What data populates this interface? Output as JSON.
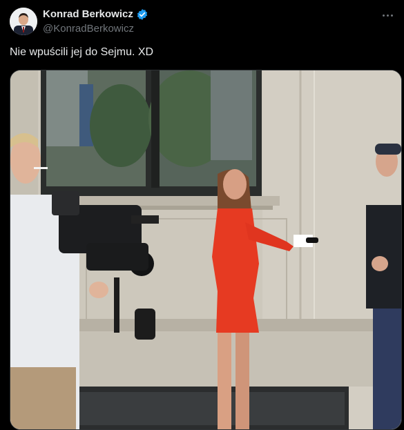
{
  "author": {
    "display_name": "Konrad Berkowicz",
    "handle": "@KonradBerkowicz"
  },
  "tweet": {
    "text": "Nie wpuścili jej do Sejmu. XD"
  },
  "icons": {
    "verified": "verified-badge-icon",
    "more": "more-options-icon"
  },
  "colors": {
    "background": "#000000",
    "text_primary": "#e7e9ea",
    "text_secondary": "#71767b",
    "verified_blue": "#1d9bf0",
    "dress_red": "#e63a22"
  }
}
